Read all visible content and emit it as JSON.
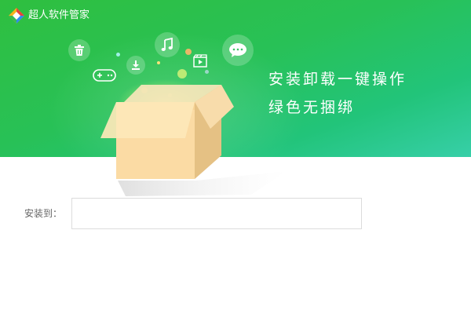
{
  "app": {
    "title": "超人软件管家",
    "logo_icon": "diamond-logo"
  },
  "hero": {
    "slogan_line1": "安装卸载一键操作",
    "slogan_line2": "绿色无捆绑",
    "icons": [
      "trash-icon",
      "download-icon",
      "gamepad-icon",
      "music-note-icon",
      "video-icon",
      "chat-bubble-icon"
    ]
  },
  "install": {
    "label": "安装到：",
    "path_value": ""
  },
  "colors": {
    "hero_green": "#2fbf3f",
    "hero_teal": "#37cfa8",
    "box_front": "#fbdca4",
    "box_side": "#e9c58b"
  }
}
